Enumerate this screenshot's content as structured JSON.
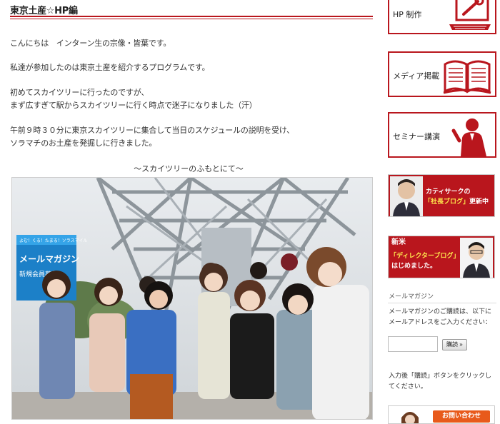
{
  "post": {
    "title": "東京土産☆HP編",
    "p1": "こんにちは　インターン生の宗像・皆葉です。",
    "p2": "私達が参加したのは東京土産を紹介するプログラムです。",
    "p3": "初めてスカイツリーに行ったのですが、\nまず広すぎて駅からスカイツリーに行く時点で迷子になりました（汗）",
    "p4": "午前９時３０分に東京スカイツリーに集合して当日のスケジュールの説明を受け、\nソラマチのお土産を発掘しに行きました。",
    "caption": "〜スカイツリーのふもとにて〜",
    "photo_sign": {
      "line1": "よむ！くる！たまる！ソラスマイル",
      "line2": "メールマガジン",
      "line3": "新規会員募集"
    }
  },
  "sidebar": {
    "menu": [
      {
        "label": "HP 制作",
        "icon": "laptop-wrench-icon"
      },
      {
        "label": "メディア掲載",
        "icon": "open-book-icon"
      },
      {
        "label": "セミナー講演",
        "icon": "speaker-silhouette-icon"
      }
    ],
    "banner_president": {
      "line1": "カティサークの",
      "line2a": "「社長ブログ」",
      "line2b": "更新中"
    },
    "banner_director": {
      "tag": "新米",
      "line1": "「ディレクターブログ」",
      "line2": "はじめました。"
    },
    "mailmag": {
      "title": "メールマガジン",
      "desc": "メールマガジンのご購読は、以下にメールアドレスをご入力ください：",
      "button": "購読 »",
      "note": "入力後「購読」ボタンをクリックしてください。"
    },
    "contact": {
      "button": "お問い合わせ"
    }
  },
  "colors": {
    "accent": "#b9161d",
    "contact": "#e85a1b"
  }
}
